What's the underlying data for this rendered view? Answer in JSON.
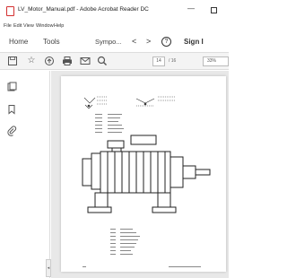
{
  "window": {
    "title": "LV_Motor_Manual.pdf - Adobe Acrobat Reader DC",
    "minimize_glyph": "—",
    "restore_glyph": "☐"
  },
  "menu": [
    "File",
    "Edit",
    "View",
    "Window",
    "Help"
  ],
  "nav": {
    "home": "Home",
    "tools": "Tools",
    "doc_tab": "Sympo...",
    "prev": "<",
    "next": ">",
    "help": "?",
    "sign_in": "Sign I"
  },
  "toolbar": {
    "icons": [
      "save-icon",
      "bookmark-star-icon",
      "upload-icon",
      "print-icon",
      "email-icon",
      "search-icon"
    ],
    "page_current": "14",
    "page_total": "/ 16",
    "zoom": "33%"
  },
  "sidebar": {
    "icons": [
      "page-thumbnails-icon",
      "bookmarks-icon",
      "attachments-icon"
    ],
    "collapse": "◂"
  },
  "colors": {
    "accent": "#d32f2f",
    "toolbar_bg": "#f4f4f4",
    "viewport_bg": "#e8e8e8"
  }
}
